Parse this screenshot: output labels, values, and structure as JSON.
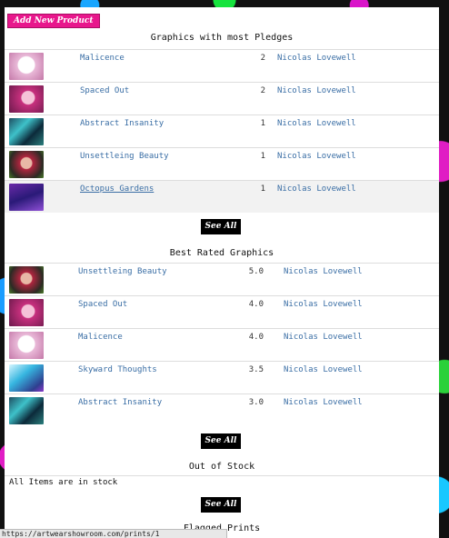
{
  "add_button": "Add New Product",
  "most_pledges": {
    "title": "Graphics with most Pledges",
    "rows": [
      {
        "name": "Malicence",
        "count": "2",
        "author": "Nicolas Lovewell",
        "thumb": "pink-white-art"
      },
      {
        "name": "Spaced Out",
        "count": "2",
        "author": "Nicolas Lovewell",
        "thumb": "pink-face-art"
      },
      {
        "name": "Abstract Insanity",
        "count": "1",
        "author": "Nicolas Lovewell",
        "thumb": "green-blue-art"
      },
      {
        "name": "Unsettleing Beauty",
        "count": "1",
        "author": "Nicolas Lovewell",
        "thumb": "red-hair-art"
      },
      {
        "name": "Octopus Gardens",
        "count": "1",
        "author": "Nicolas Lovewell",
        "thumb": "purple-art"
      }
    ],
    "see_all": "See All"
  },
  "best_rated": {
    "title": "Best Rated Graphics",
    "rows": [
      {
        "name": "Unsettleing Beauty",
        "rating": "5.0",
        "author": "Nicolas Lovewell",
        "thumb": "red-hair-art"
      },
      {
        "name": "Spaced Out",
        "rating": "4.0",
        "author": "Nicolas Lovewell",
        "thumb": "pink-face-art"
      },
      {
        "name": "Malicence",
        "rating": "4.0",
        "author": "Nicolas Lovewell",
        "thumb": "pink-white-art"
      },
      {
        "name": "Skyward Thoughts",
        "rating": "3.5",
        "author": "Nicolas Lovewell",
        "thumb": "sky-art"
      },
      {
        "name": "Abstract Insanity",
        "rating": "3.0",
        "author": "Nicolas Lovewell",
        "thumb": "green-blue-art"
      }
    ],
    "see_all": "See All"
  },
  "out_of_stock": {
    "title": "Out of Stock",
    "message": "All Items are in stock",
    "see_all": "See All"
  },
  "flagged": {
    "title": "Flagged Prints"
  },
  "status_bar": "https://artwearshowroom.com/prints/1"
}
